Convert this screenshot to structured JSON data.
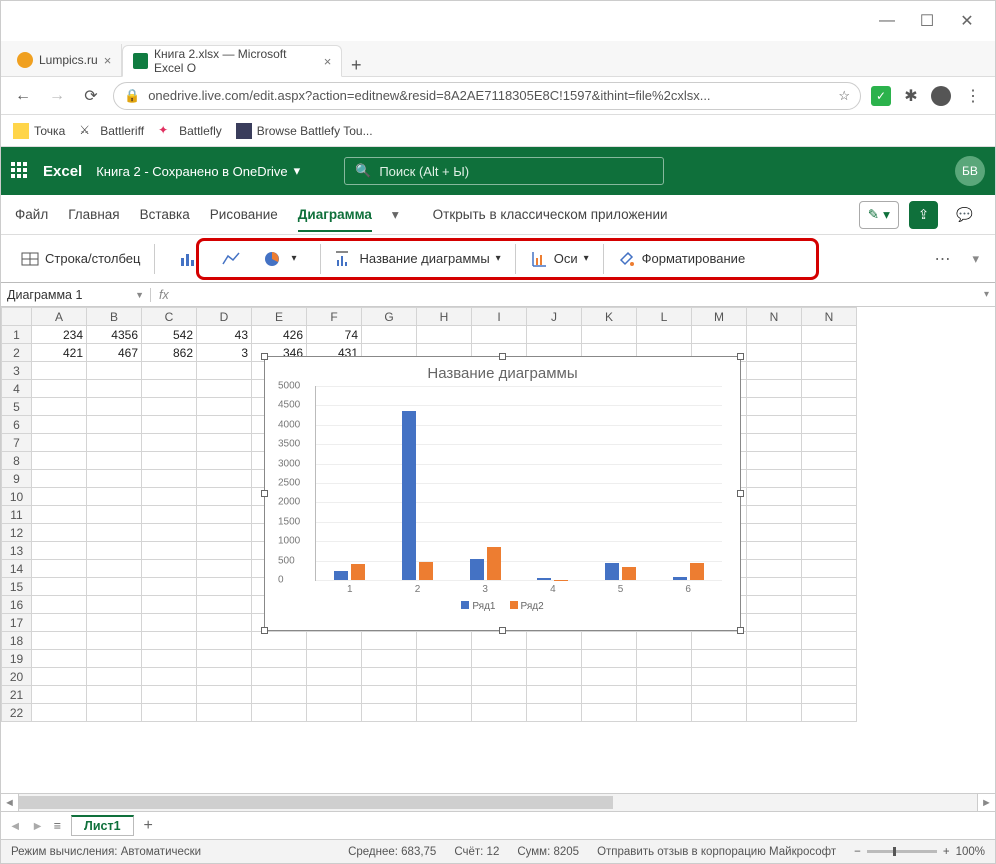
{
  "browser": {
    "tabs": [
      {
        "title": "Lumpics.ru",
        "favicon": "#f0a020"
      },
      {
        "title": "Книга 2.xlsx — Microsoft Excel O",
        "favicon": "#107c41"
      }
    ],
    "url": "onedrive.live.com/edit.aspx?action=editnew&resid=8A2AE7118305E8C!1597&ithint=file%2cxlsx...",
    "bookmarks": [
      "Точка",
      "Battleriff",
      "Battlefly",
      "Browse Battlefy Tou..."
    ]
  },
  "excel": {
    "app": "Excel",
    "doc": "Книга 2 - Сохранено в OneDrive",
    "search_placeholder": "Поиск (Alt + Ы)",
    "avatar": "БВ",
    "menu": [
      "Файл",
      "Главная",
      "Вставка",
      "Рисование",
      "Диаграмма"
    ],
    "active_menu": "Диаграмма",
    "open_desktop": "Открыть в классическом приложении",
    "ribbon": {
      "switch": "Строка/столбец",
      "chart_title": "Название диаграммы",
      "axes": "Оси",
      "formatting": "Форматирование"
    },
    "namebox": "Диаграмма 1",
    "fx": "fx",
    "columns": [
      "A",
      "B",
      "C",
      "D",
      "E",
      "F",
      "G",
      "H",
      "I",
      "J",
      "K",
      "L",
      "M",
      "N",
      "N"
    ],
    "rows": [
      1,
      2,
      3,
      4,
      5,
      6,
      7,
      8,
      9,
      10,
      11,
      12,
      13,
      14,
      15,
      16,
      17,
      18,
      19,
      20,
      21,
      22
    ],
    "data": [
      [
        234,
        4356,
        542,
        43,
        426,
        74
      ],
      [
        421,
        467,
        862,
        3,
        346,
        431
      ]
    ],
    "sheet": "Лист1",
    "status": {
      "calc": "Режим вычисления: Автоматически",
      "avg": "Среднее: 683,75",
      "count": "Счёт: 12",
      "sum": "Сумм: 8205",
      "feedback": "Отправить отзыв в корпорацию Майкрософт",
      "zoom": "100%"
    }
  },
  "chart_data": {
    "type": "bar",
    "title": "Название диаграммы",
    "categories": [
      1,
      2,
      3,
      4,
      5,
      6
    ],
    "series": [
      {
        "name": "Ряд1",
        "values": [
          234,
          4356,
          542,
          43,
          426,
          74
        ]
      },
      {
        "name": "Ряд2",
        "values": [
          421,
          467,
          862,
          3,
          346,
          431
        ]
      }
    ],
    "ylim": [
      0,
      5000
    ],
    "yticks": [
      0,
      500,
      1000,
      1500,
      2000,
      2500,
      3000,
      3500,
      4000,
      4500,
      5000
    ],
    "colors": {
      "Ряд1": "#4472c4",
      "Ряд2": "#ed7d31"
    }
  }
}
